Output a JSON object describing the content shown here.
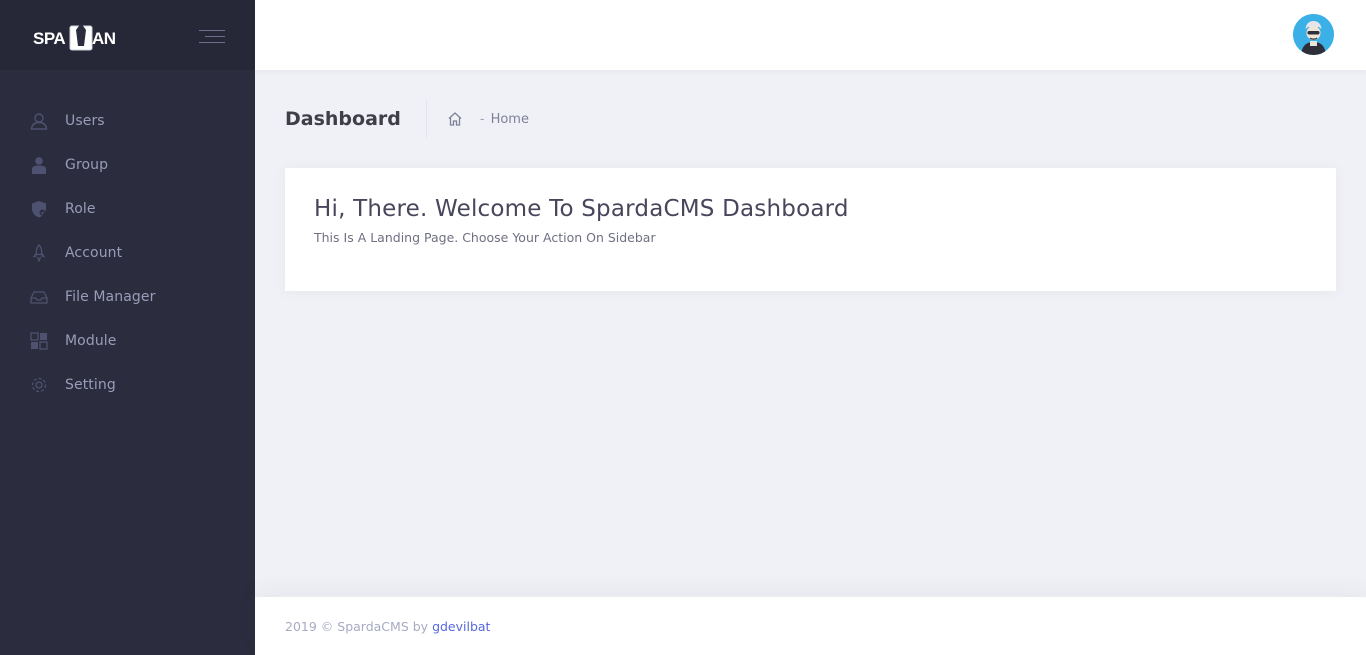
{
  "brand": {
    "logo_text": "SPARTAN",
    "accent": "#2b2c3d"
  },
  "sidebar": {
    "items": [
      {
        "label": "Users",
        "icon": "users-icon"
      },
      {
        "label": "Group",
        "icon": "group-icon"
      },
      {
        "label": "Role",
        "icon": "shield-icon"
      },
      {
        "label": "Account",
        "icon": "rocket-icon"
      },
      {
        "label": "File Manager",
        "icon": "inbox-icon"
      },
      {
        "label": "Module",
        "icon": "layout-icon"
      },
      {
        "label": "Setting",
        "icon": "gear-icon"
      }
    ]
  },
  "subheader": {
    "title": "Dashboard",
    "breadcrumb_separator": "-",
    "breadcrumb_item": "Home"
  },
  "card": {
    "heading": "Hi, There. Welcome To SpardaCMS Dashboard",
    "text": "This Is A Landing Page. Choose Your Action On Sidebar"
  },
  "footer": {
    "text": "2019 © SpardaCMS by",
    "link": "gdevilbat",
    "link_color": "#5867dd"
  },
  "colors": {
    "sidebar_bg": "#2b2c3d",
    "content_bg": "#f0f1f6",
    "avatar_bg": "#3ab0e6"
  }
}
